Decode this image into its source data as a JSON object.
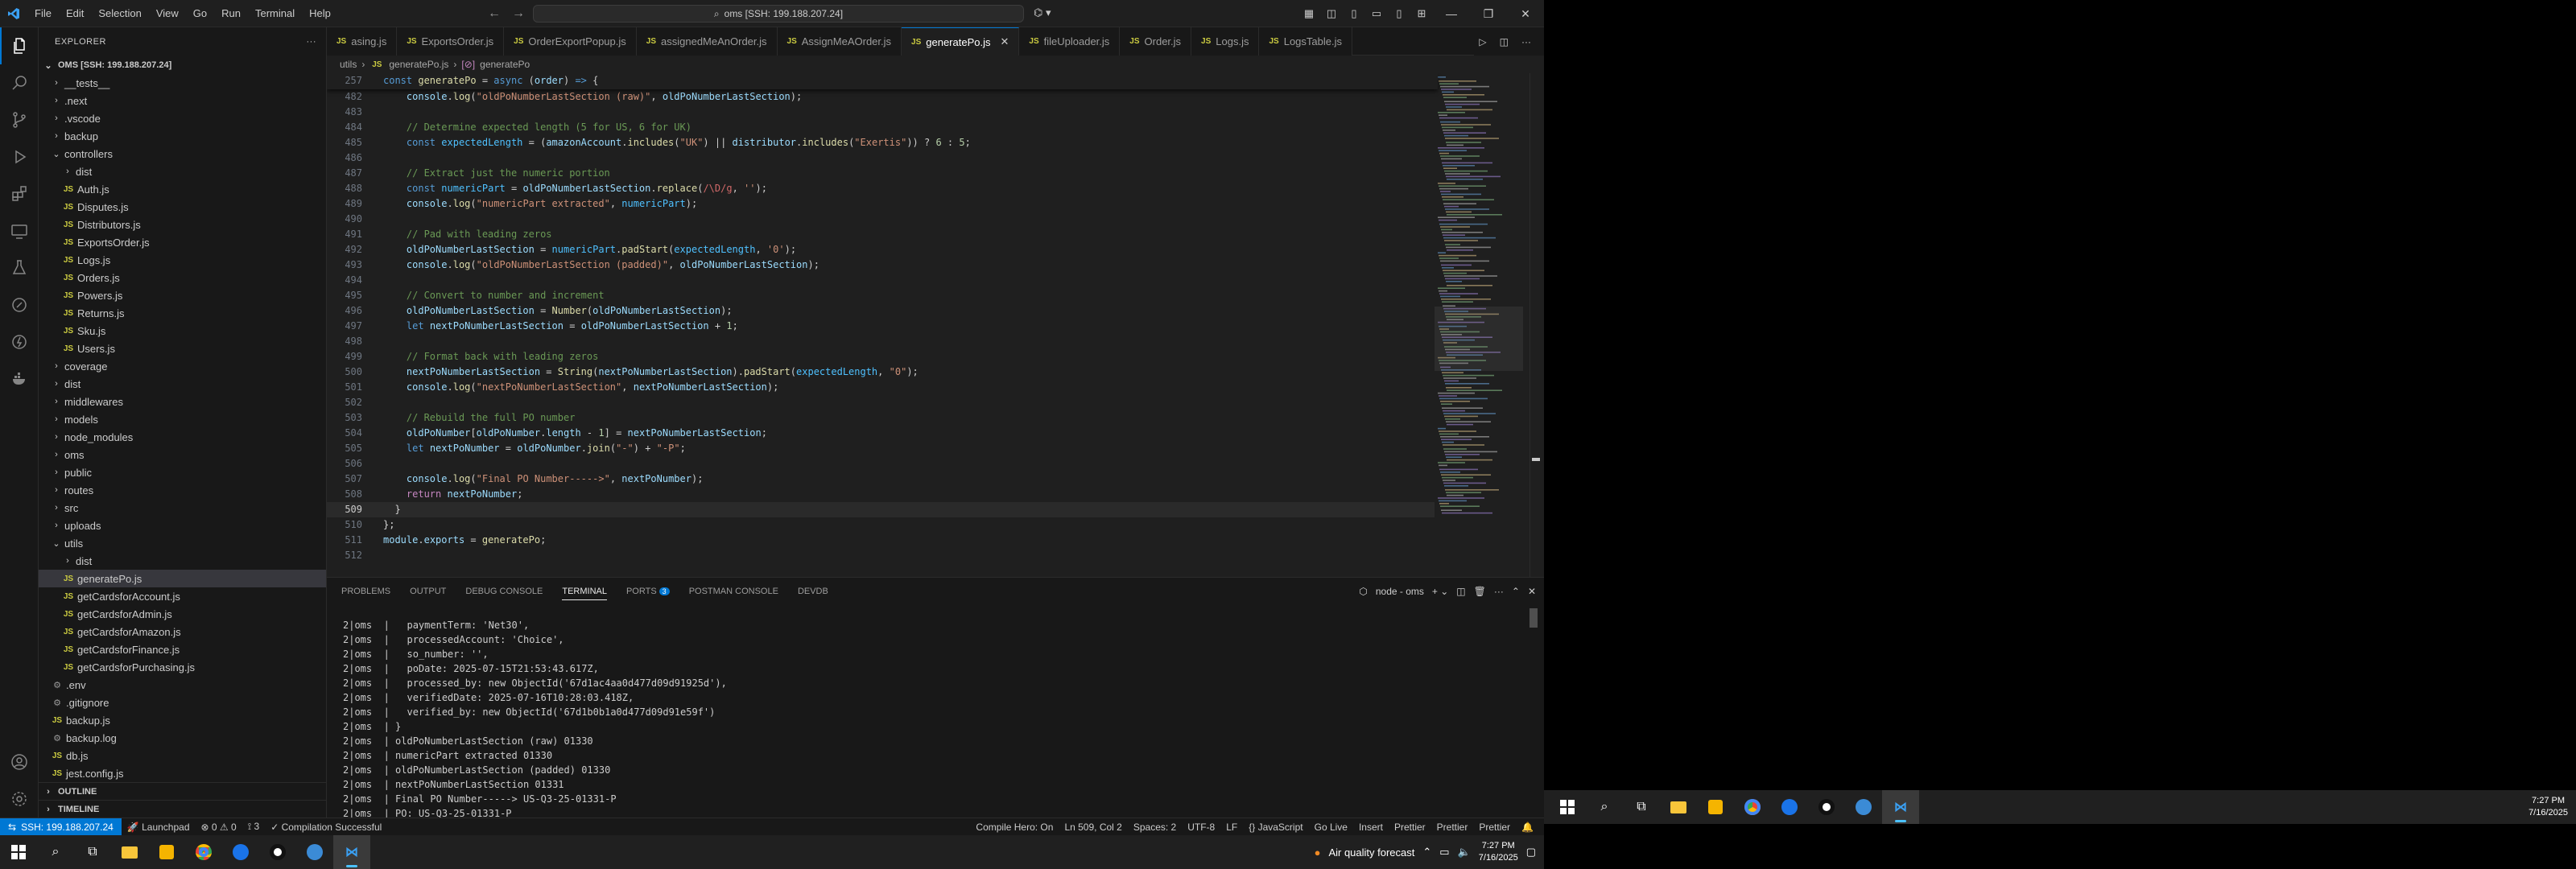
{
  "titlebar": {
    "menus": [
      "File",
      "Edit",
      "Selection",
      "View",
      "Go",
      "Run",
      "Terminal",
      "Help"
    ],
    "search": "oms [SSH: 199.188.207.24]"
  },
  "explorer": {
    "title": "EXPLORER",
    "root": "OMS [SSH: 199.188.207.24]",
    "items": [
      {
        "name": "__tests__",
        "type": "folder",
        "depth": 0
      },
      {
        "name": ".next",
        "type": "folder",
        "depth": 0
      },
      {
        "name": ".vscode",
        "type": "folder",
        "depth": 0
      },
      {
        "name": "backup",
        "type": "folder",
        "depth": 0
      },
      {
        "name": "controllers",
        "type": "folder-open",
        "depth": 0
      },
      {
        "name": "dist",
        "type": "folder",
        "depth": 1
      },
      {
        "name": "Auth.js",
        "type": "js",
        "depth": 1
      },
      {
        "name": "Disputes.js",
        "type": "js",
        "depth": 1
      },
      {
        "name": "Distributors.js",
        "type": "js",
        "depth": 1
      },
      {
        "name": "ExportsOrder.js",
        "type": "js",
        "depth": 1
      },
      {
        "name": "Logs.js",
        "type": "js",
        "depth": 1
      },
      {
        "name": "Orders.js",
        "type": "js",
        "depth": 1
      },
      {
        "name": "Powers.js",
        "type": "js",
        "depth": 1
      },
      {
        "name": "Returns.js",
        "type": "js",
        "depth": 1
      },
      {
        "name": "Sku.js",
        "type": "js",
        "depth": 1
      },
      {
        "name": "Users.js",
        "type": "js",
        "depth": 1
      },
      {
        "name": "coverage",
        "type": "folder",
        "depth": 0
      },
      {
        "name": "dist",
        "type": "folder",
        "depth": 0
      },
      {
        "name": "middlewares",
        "type": "folder",
        "depth": 0
      },
      {
        "name": "models",
        "type": "folder",
        "depth": 0
      },
      {
        "name": "node_modules",
        "type": "folder",
        "depth": 0
      },
      {
        "name": "oms",
        "type": "folder",
        "depth": 0
      },
      {
        "name": "public",
        "type": "folder",
        "depth": 0
      },
      {
        "name": "routes",
        "type": "folder",
        "depth": 0
      },
      {
        "name": "src",
        "type": "folder",
        "depth": 0
      },
      {
        "name": "uploads",
        "type": "folder",
        "depth": 0
      },
      {
        "name": "utils",
        "type": "folder-open",
        "depth": 0
      },
      {
        "name": "dist",
        "type": "folder",
        "depth": 1
      },
      {
        "name": "generatePo.js",
        "type": "js",
        "depth": 1,
        "selected": true
      },
      {
        "name": "getCardsforAccount.js",
        "type": "js",
        "depth": 1
      },
      {
        "name": "getCardsforAdmin.js",
        "type": "js",
        "depth": 1
      },
      {
        "name": "getCardsforAmazon.js",
        "type": "js",
        "depth": 1
      },
      {
        "name": "getCardsforFinance.js",
        "type": "js",
        "depth": 1
      },
      {
        "name": "getCardsforPurchasing.js",
        "type": "js",
        "depth": 1
      },
      {
        "name": ".env",
        "type": "env",
        "depth": 0
      },
      {
        "name": ".gitignore",
        "type": "env",
        "depth": 0
      },
      {
        "name": "backup.js",
        "type": "js",
        "depth": 0
      },
      {
        "name": "backup.log",
        "type": "env",
        "depth": 0
      },
      {
        "name": "db.js",
        "type": "js",
        "depth": 0
      },
      {
        "name": "jest.config.js",
        "type": "js",
        "depth": 0
      }
    ],
    "outline": "OUTLINE",
    "timeline": "TIMELINE"
  },
  "tabs": [
    {
      "label": "asing.js",
      "active": false
    },
    {
      "label": "ExportsOrder.js",
      "active": false
    },
    {
      "label": "OrderExportPopup.js",
      "active": false
    },
    {
      "label": "assignedMeAnOrder.js",
      "active": false
    },
    {
      "label": "AssignMeAOrder.js",
      "active": false
    },
    {
      "label": "generatePo.js",
      "active": true
    },
    {
      "label": "fileUploader.js",
      "active": false
    },
    {
      "label": "Order.js",
      "active": false
    },
    {
      "label": "Logs.js",
      "active": false
    },
    {
      "label": "LogsTable.js",
      "active": false
    }
  ],
  "breadcrumb": {
    "folder": "utils",
    "file": "generatePo.js",
    "symbol": "generatePo"
  },
  "editor": {
    "sticky": {
      "ln": "257",
      "text": "const generatePo = async (order) => {"
    },
    "lines": [
      {
        "ln": "482",
        "html": "    <span class='var'>console</span>.<span class='fn'>log</span>(<span class='str'>\"oldPoNumberLastSection (raw)\"</span>, <span class='var'>oldPoNumberLastSection</span>);"
      },
      {
        "ln": "483",
        "html": ""
      },
      {
        "ln": "484",
        "html": "    <span class='cmt'>// Determine expected length (5 for US, 6 for UK)</span>"
      },
      {
        "ln": "485",
        "html": "    <span class='kw'>const</span> <span class='cst'>expectedLength</span> = (<span class='var'>amazonAccount</span>.<span class='fn'>includes</span>(<span class='str'>\"UK\"</span>) || <span class='var'>distributor</span>.<span class='fn'>includes</span>(<span class='str'>\"Exertis\"</span>)) ? <span class='num'>6</span> : <span class='num'>5</span>;"
      },
      {
        "ln": "486",
        "html": ""
      },
      {
        "ln": "487",
        "html": "    <span class='cmt'>// Extract just the numeric portion</span>"
      },
      {
        "ln": "488",
        "html": "    <span class='kw'>const</span> <span class='cst'>numericPart</span> = <span class='var'>oldPoNumberLastSection</span>.<span class='fn'>replace</span>(<span class='rx'>/\\D/g</span>, <span class='str'>''</span>);"
      },
      {
        "ln": "489",
        "html": "    <span class='var'>console</span>.<span class='fn'>log</span>(<span class='str'>\"numericPart extracted\"</span>, <span class='cst'>numericPart</span>);"
      },
      {
        "ln": "490",
        "html": ""
      },
      {
        "ln": "491",
        "html": "    <span class='cmt'>// Pad with leading zeros</span>"
      },
      {
        "ln": "492",
        "html": "    <span class='var'>oldPoNumberLastSection</span> = <span class='cst'>numericPart</span>.<span class='fn'>padStart</span>(<span class='cst'>expectedLength</span>, <span class='str'>'0'</span>);"
      },
      {
        "ln": "493",
        "html": "    <span class='var'>console</span>.<span class='fn'>log</span>(<span class='str'>\"oldPoNumberLastSection (padded)\"</span>, <span class='var'>oldPoNumberLastSection</span>);"
      },
      {
        "ln": "494",
        "html": ""
      },
      {
        "ln": "495",
        "html": "    <span class='cmt'>// Convert to number and increment</span>"
      },
      {
        "ln": "496",
        "html": "    <span class='var'>oldPoNumberLastSection</span> = <span class='fn'>Number</span>(<span class='var'>oldPoNumberLastSection</span>);"
      },
      {
        "ln": "497",
        "html": "    <span class='kw'>let</span> <span class='var'>nextPoNumberLastSection</span> = <span class='var'>oldPoNumberLastSection</span> + <span class='num'>1</span>;"
      },
      {
        "ln": "498",
        "html": ""
      },
      {
        "ln": "499",
        "html": "    <span class='cmt'>// Format back with leading zeros</span>"
      },
      {
        "ln": "500",
        "html": "    <span class='var'>nextPoNumberLastSection</span> = <span class='fn'>String</span>(<span class='var'>nextPoNumberLastSection</span>).<span class='fn'>padStart</span>(<span class='cst'>expectedLength</span>, <span class='str'>\"0\"</span>);"
      },
      {
        "ln": "501",
        "html": "    <span class='var'>console</span>.<span class='fn'>log</span>(<span class='str'>\"nextPoNumberLastSection\"</span>, <span class='var'>nextPoNumberLastSection</span>);"
      },
      {
        "ln": "502",
        "html": ""
      },
      {
        "ln": "503",
        "html": "    <span class='cmt'>// Rebuild the full PO number</span>"
      },
      {
        "ln": "504",
        "html": "    <span class='var'>oldPoNumber</span>[<span class='var'>oldPoNumber</span>.<span class='var'>length</span> - <span class='num'>1</span>] = <span class='var'>nextPoNumberLastSection</span>;"
      },
      {
        "ln": "505",
        "html": "    <span class='kw'>let</span> <span class='var'>nextPoNumber</span> = <span class='var'>oldPoNumber</span>.<span class='fn'>join</span>(<span class='str'>\"-\"</span>) + <span class='str'>\"-P\"</span>;"
      },
      {
        "ln": "506",
        "html": ""
      },
      {
        "ln": "507",
        "html": "    <span class='var'>console</span>.<span class='fn'>log</span>(<span class='str'>\"Final PO Number-----&gt;\"</span>, <span class='var'>nextPoNumber</span>);"
      },
      {
        "ln": "508",
        "html": "    <span class='kw2'>return</span> <span class='var'>nextPoNumber</span>;"
      },
      {
        "ln": "509",
        "html": "  <span class='pn'>}</span>",
        "current": true
      },
      {
        "ln": "510",
        "html": "<span class='pn'>};</span>"
      },
      {
        "ln": "511",
        "html": "<span class='var'>module</span>.<span class='var'>exports</span> = <span class='fn'>generatePo</span>;"
      },
      {
        "ln": "512",
        "html": ""
      }
    ]
  },
  "panel": {
    "tabs": [
      "PROBLEMS",
      "OUTPUT",
      "DEBUG CONSOLE",
      "TERMINAL",
      "PORTS",
      "POSTMAN CONSOLE",
      "DEVDB"
    ],
    "active_tab": "TERMINAL",
    "ports_badge": "3",
    "terminal_name": "node - oms",
    "lines": [
      "2|oms  |   paymentTerm: 'Net30',",
      "2|oms  |   processedAccount: 'Choice',",
      "2|oms  |   so_number: '',",
      "2|oms  |   poDate: 2025-07-15T21:53:43.617Z,",
      "2|oms  |   processed_by: new ObjectId('67d1ac4aa0d477d09d91925d'),",
      "2|oms  |   verifiedDate: 2025-07-16T10:28:03.418Z,",
      "2|oms  |   verified_by: new ObjectId('67d1b0b1a0d477d09d91e59f')",
      "2|oms  | }",
      "2|oms  | oldPoNumberLastSection (raw) 01330",
      "2|oms  | numericPart extracted 01330",
      "2|oms  | oldPoNumberLastSection (padded) 01330",
      "2|oms  | nextPoNumberLastSection 01331",
      "2|oms  | Final PO Number-----> US-Q3-25-01331-P",
      "2|oms  | PO: US-Q3-25-01331-P"
    ]
  },
  "statusbar": {
    "remote": "SSH: 199.188.207.24",
    "launchpad": "Launchpad",
    "errors": "0",
    "warnings": "0",
    "ports": "3",
    "compilation": "Compilation Successful",
    "right": [
      "Compile Hero: On",
      "Ln 509, Col 2",
      "Spaces: 2",
      "UTF-8",
      "LF",
      "{} JavaScript",
      "Go Live",
      "Insert",
      "Prettier",
      "Prettier",
      "Prettier"
    ]
  },
  "taskbar": {
    "weather": "Air quality forecast",
    "time": "7:27 PM",
    "date": "7/16/2025"
  }
}
